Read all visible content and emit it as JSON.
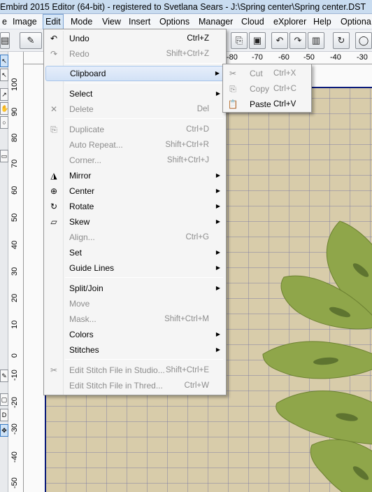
{
  "window": {
    "title": "Embird 2015 Editor (64-bit) - registered to Svetlana Sears - J:\\Spring center\\Spring center.DST"
  },
  "menubar": {
    "items": [
      "e",
      "Image",
      "Edit",
      "Mode",
      "View",
      "Insert",
      "Options",
      "Manager",
      "Cloud",
      "eXplorer",
      "Help",
      "Optiona"
    ],
    "active": "Edit"
  },
  "hruler": {
    "labels": [
      "-80",
      "-70",
      "-60",
      "-50",
      "-40",
      "-30"
    ]
  },
  "vruler": {
    "labels": [
      "100",
      "90",
      "80",
      "70",
      "60",
      "50",
      "40",
      "30",
      "20",
      "10",
      "0",
      "-10",
      "-20",
      "-30",
      "-40",
      "-50"
    ]
  },
  "edit_menu": {
    "items": [
      {
        "icon": "undo-icon",
        "glyph": "↶",
        "label": "Undo",
        "shortcut": "Ctrl+Z",
        "disabled": false
      },
      {
        "icon": "redo-icon",
        "glyph": "↷",
        "label": "Redo",
        "shortcut": "Shift+Ctrl+Z",
        "disabled": true
      },
      {
        "icon": "",
        "glyph": "",
        "label": "Clipboard",
        "shortcut": "",
        "submenu": true,
        "highlighted": true
      },
      {
        "icon": "",
        "glyph": "",
        "label": "Select",
        "shortcut": "",
        "submenu": true
      },
      {
        "icon": "delete-icon",
        "glyph": "✕",
        "label": "Delete",
        "shortcut": "Del",
        "disabled": true
      },
      {
        "icon": "duplicate-icon",
        "glyph": "⎘",
        "label": "Duplicate",
        "shortcut": "Ctrl+D",
        "disabled": true
      },
      {
        "icon": "",
        "glyph": "",
        "label": "Auto Repeat...",
        "shortcut": "Shift+Ctrl+R",
        "disabled": true
      },
      {
        "icon": "",
        "glyph": "",
        "label": "Corner...",
        "shortcut": "Shift+Ctrl+J",
        "disabled": true
      },
      {
        "icon": "mirror-icon",
        "glyph": "◮",
        "label": "Mirror",
        "shortcut": "",
        "submenu": true
      },
      {
        "icon": "center-icon",
        "glyph": "⊕",
        "label": "Center",
        "shortcut": "",
        "submenu": true
      },
      {
        "icon": "rotate-icon",
        "glyph": "↻",
        "label": "Rotate",
        "shortcut": "",
        "submenu": true
      },
      {
        "icon": "skew-icon",
        "glyph": "▱",
        "label": "Skew",
        "shortcut": "",
        "submenu": true
      },
      {
        "icon": "",
        "glyph": "",
        "label": "Align...",
        "shortcut": "Ctrl+G",
        "disabled": true
      },
      {
        "icon": "",
        "glyph": "",
        "label": "Set",
        "shortcut": "",
        "submenu": true
      },
      {
        "icon": "",
        "glyph": "",
        "label": "Guide Lines",
        "shortcut": "",
        "submenu": true
      },
      {
        "icon": "",
        "glyph": "",
        "label": "Split/Join",
        "shortcut": "",
        "submenu": true
      },
      {
        "icon": "",
        "glyph": "",
        "label": "Move",
        "shortcut": "",
        "disabled": true
      },
      {
        "icon": "",
        "glyph": "",
        "label": "Mask...",
        "shortcut": "Shift+Ctrl+M",
        "disabled": true
      },
      {
        "icon": "",
        "glyph": "",
        "label": "Colors",
        "shortcut": "",
        "submenu": true
      },
      {
        "icon": "",
        "glyph": "",
        "label": "Stitches",
        "shortcut": "",
        "submenu": true
      },
      {
        "icon": "edit-studio-icon",
        "glyph": "✂",
        "label": "Edit Stitch File in Studio...",
        "shortcut": "Shift+Ctrl+E",
        "disabled": true
      },
      {
        "icon": "",
        "glyph": "",
        "label": "Edit Stitch File in Thred...",
        "shortcut": "Ctrl+W",
        "disabled": true
      }
    ]
  },
  "clipboard_submenu": {
    "items": [
      {
        "icon": "cut-icon",
        "glyph": "✂",
        "label": "Cut",
        "shortcut": "Ctrl+X",
        "disabled": true
      },
      {
        "icon": "copy-icon",
        "glyph": "⎘",
        "label": "Copy",
        "shortcut": "Ctrl+C",
        "disabled": true
      },
      {
        "icon": "paste-icon",
        "glyph": "📋",
        "label": "Paste",
        "shortcut": "Ctrl+V",
        "disabled": false
      }
    ]
  },
  "colors": {
    "hoop_bg": "#d8ccaa",
    "hoop_border": "#0a1a7a",
    "leaf_green": "#8fa64a",
    "flower_blue": "#3a8fd8"
  }
}
